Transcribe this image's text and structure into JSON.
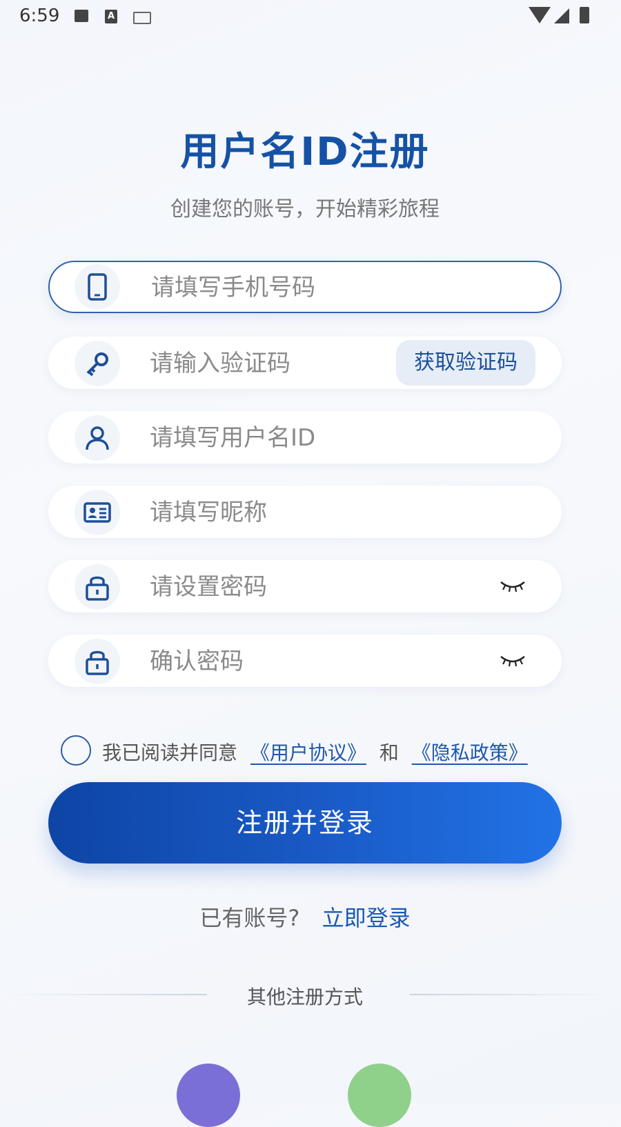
{
  "status_bar": {
    "time": "6:59",
    "icons": [
      "image-icon",
      "a-icon",
      "keyboard-icon",
      "wifi-icon",
      "signal-icon",
      "battery-icon"
    ]
  },
  "header": {
    "title": "用户名ID注册",
    "subtitle": "创建您的账号，开始精彩旅程"
  },
  "form": {
    "phone": {
      "placeholder": "请填写手机号码",
      "icon": "phone-icon"
    },
    "code": {
      "placeholder": "请输入验证码",
      "icon": "key-icon",
      "button_label": "获取验证码"
    },
    "username": {
      "placeholder": "请填写用户名ID",
      "icon": "user-icon"
    },
    "nickname": {
      "placeholder": "请填写昵称",
      "icon": "id-card-icon"
    },
    "password": {
      "placeholder": "请设置密码",
      "icon": "lock-icon",
      "toggle_icon": "eye-closed-icon"
    },
    "confirm_password": {
      "placeholder": "确认密码",
      "icon": "lock-icon",
      "toggle_icon": "eye-closed-icon"
    }
  },
  "agreement": {
    "prefix": "我已阅读并同意",
    "user_agreement": "《用户协议》",
    "and": "和",
    "privacy_policy": "《隐私政策》",
    "checked": false
  },
  "actions": {
    "register_label": "注册并登录"
  },
  "login": {
    "label": "已有账号?",
    "link": "立即登录"
  },
  "other": {
    "label": "其他注册方式"
  },
  "colors": {
    "accent": "#1552a6",
    "button_start": "#0e45a5",
    "button_end": "#2173e6",
    "link": "#1f58a8"
  }
}
